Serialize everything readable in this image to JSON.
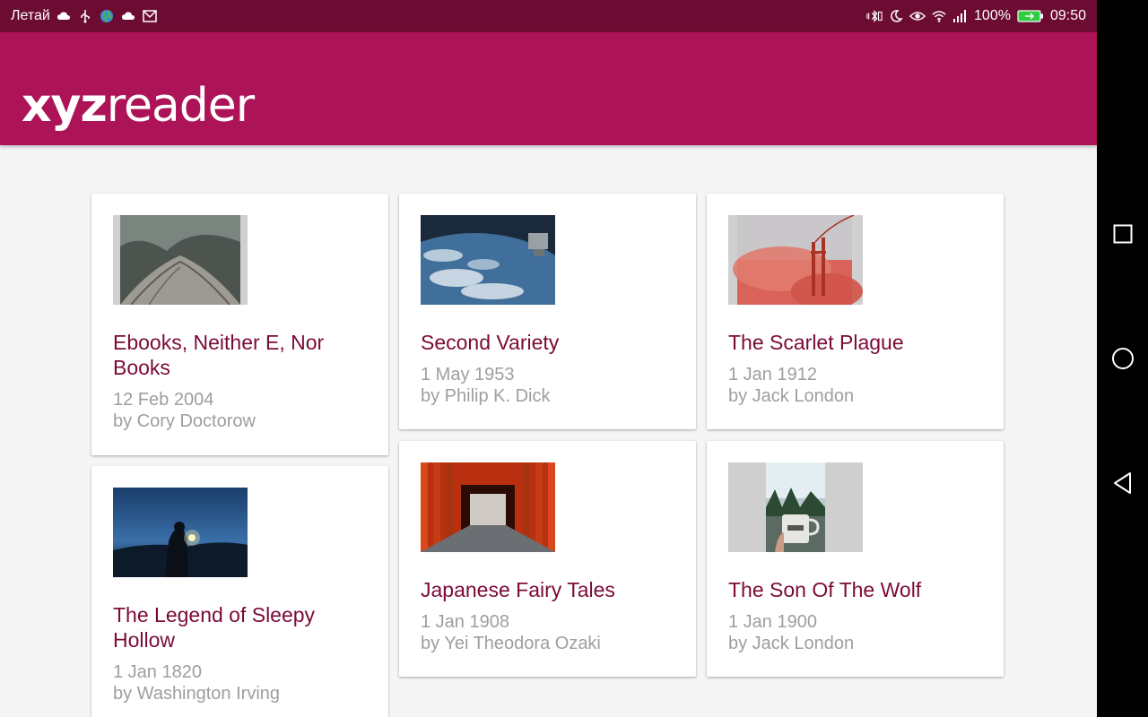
{
  "statusbar": {
    "carrier": "Летай",
    "battery_percent": "100%",
    "time": "09:50"
  },
  "app": {
    "logo_bold": "xyz",
    "logo_light": "reader",
    "brand_color": "#ad1457",
    "title_color": "#7b0a37"
  },
  "articles": [
    {
      "title": "Ebooks, Neither E, Nor Books",
      "date": "12 Feb 2004",
      "author": "by Cory Doctorow",
      "image": "glass-curves-photo"
    },
    {
      "title": "Second Variety",
      "date": "1 May 1953",
      "author": "by Philip K. Dick",
      "image": "earth-from-orbit-photo"
    },
    {
      "title": "The Scarlet Plague",
      "date": "1 Jan 1912",
      "author": "by Jack London",
      "image": "bridge-in-red-fog-photo"
    },
    {
      "title": "The Legend of Sleepy Hollow",
      "date": "1 Jan 1820",
      "author": "by Washington Irving",
      "image": "lantern-at-dusk-photo"
    },
    {
      "title": "Japanese Fairy Tales",
      "date": "1 Jan 1908",
      "author": "by Yei Theodora Ozaki",
      "image": "torii-gates-photo"
    },
    {
      "title": "The Son Of The Wolf",
      "date": "1 Jan 1900",
      "author": "by Jack London",
      "image": "camp-mug-photo"
    }
  ]
}
